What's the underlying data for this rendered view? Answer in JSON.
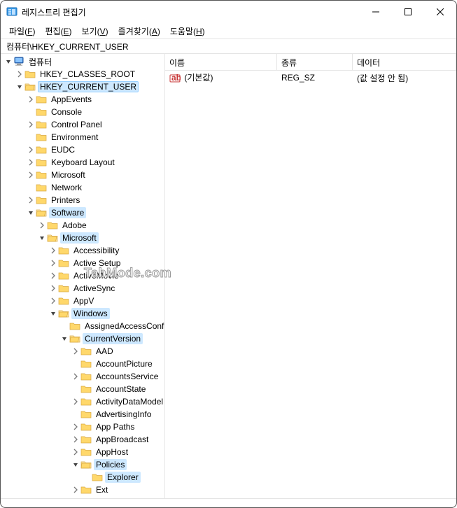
{
  "window": {
    "title": "레지스트리 편집기"
  },
  "menu": {
    "file": {
      "label": "파일",
      "accel": "F"
    },
    "edit": {
      "label": "편집",
      "accel": "E"
    },
    "view": {
      "label": "보기",
      "accel": "V"
    },
    "fav": {
      "label": "즐겨찾기",
      "accel": "A"
    },
    "help": {
      "label": "도움말",
      "accel": "H"
    }
  },
  "address": "컴퓨터\\HKEY_CURRENT_USER",
  "tree": {
    "root": "컴퓨터",
    "hkcr": "HKEY_CLASSES_ROOT",
    "hkcu": "HKEY_CURRENT_USER",
    "appevents": "AppEvents",
    "console": "Console",
    "controlpanel": "Control Panel",
    "environment": "Environment",
    "eudc": "EUDC",
    "keyboard": "Keyboard Layout",
    "microsoft_top": "Microsoft",
    "network": "Network",
    "printers": "Printers",
    "software": "Software",
    "adobe": "Adobe",
    "microsoft": "Microsoft",
    "accessibility": "Accessibility",
    "activesetup": "Active Setup",
    "activemovie": "ActiveMovie",
    "activesync": "ActiveSync",
    "appv": "AppV",
    "windows": "Windows",
    "assignedaccess": "AssignedAccessConfiguration",
    "currentversion": "CurrentVersion",
    "aad": "AAD",
    "accountpicture": "AccountPicture",
    "accountsservice": "AccountsService",
    "accountstate": "AccountState",
    "activitydatamodel": "ActivityDataModel",
    "advertisinginfo": "AdvertisingInfo",
    "apppaths": "App Paths",
    "appbroadcast": "AppBroadcast",
    "apphost": "AppHost",
    "policies": "Policies",
    "explorer": "Explorer",
    "ext": "Ext"
  },
  "list": {
    "cols": {
      "name": "이름",
      "type": "종류",
      "data": "데이터"
    },
    "rows": [
      {
        "name": "(기본값)",
        "type": "REG_SZ",
        "data": "(값 설정 안 됨)"
      }
    ]
  },
  "watermark": "TabMode.com"
}
